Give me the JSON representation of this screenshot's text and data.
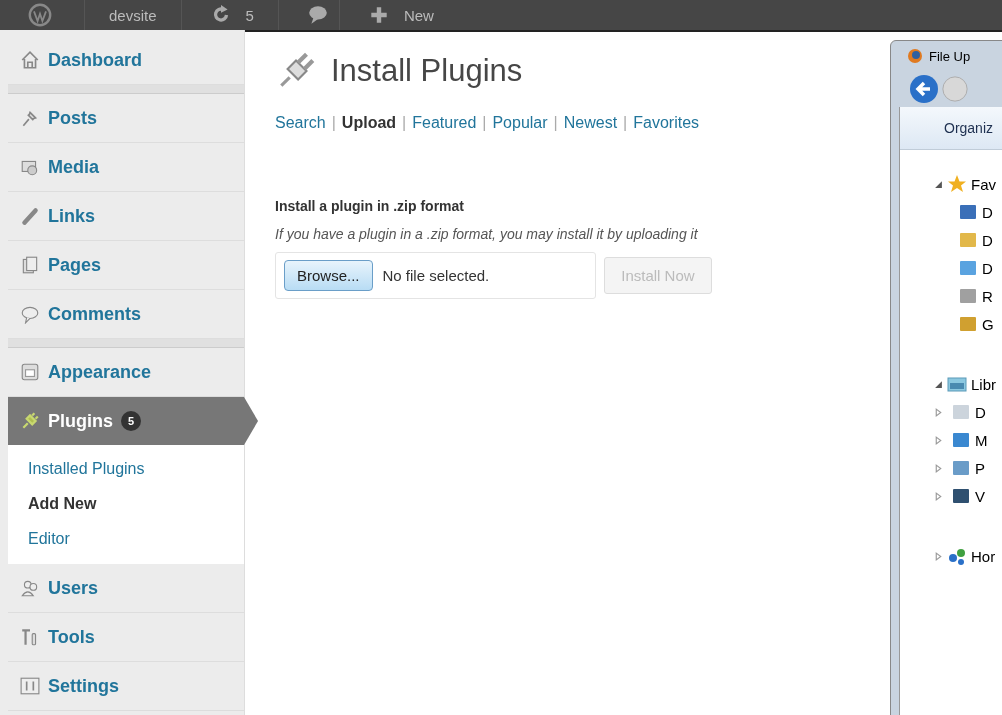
{
  "admin_bar": {
    "site": "devsite",
    "updates": "5",
    "new": "New"
  },
  "sidebar": {
    "items": [
      {
        "label": "Dashboard",
        "selected": false,
        "separator_after": true
      },
      {
        "label": "Posts",
        "selected": false
      },
      {
        "label": "Media",
        "selected": false
      },
      {
        "label": "Links",
        "selected": false
      },
      {
        "label": "Pages",
        "selected": false
      },
      {
        "label": "Comments",
        "selected": false,
        "separator_after": true
      },
      {
        "label": "Appearance",
        "selected": false
      },
      {
        "label": "Plugins",
        "selected": true,
        "badge": "5",
        "children": [
          {
            "label": "Installed Plugins",
            "selected": false
          },
          {
            "label": "Add New",
            "selected": true
          },
          {
            "label": "Editor",
            "selected": false
          }
        ]
      },
      {
        "label": "Users",
        "selected": false
      },
      {
        "label": "Tools",
        "selected": false
      },
      {
        "label": "Settings",
        "selected": false
      }
    ]
  },
  "page": {
    "title": "Install Plugins",
    "tabs": [
      {
        "label": "Search",
        "selected": false
      },
      {
        "label": "Upload",
        "selected": true
      },
      {
        "label": "Featured",
        "selected": false
      },
      {
        "label": "Popular",
        "selected": false
      },
      {
        "label": "Newest",
        "selected": false
      },
      {
        "label": "Favorites",
        "selected": false
      }
    ],
    "tab_separator": "|",
    "heading": "Install a plugin in .zip format",
    "description": "If you have a plugin in a .zip format, you may install it by uploading it",
    "browse_button": "Browse...",
    "file_status": "No file selected.",
    "install_button": "Install Now",
    "install_disabled": true
  },
  "dialog": {
    "title": "File Up",
    "toolbar": "Organiz",
    "tree": [
      {
        "label": "Fav",
        "expanded": true,
        "children": [
          {
            "label": "D"
          },
          {
            "label": "D"
          },
          {
            "label": "D"
          },
          {
            "label": "R"
          },
          {
            "label": "G"
          }
        ]
      },
      {
        "label": "Libr",
        "expanded": true,
        "children": [
          {
            "label": "D",
            "expanded": false
          },
          {
            "label": "M",
            "expanded": false
          },
          {
            "label": "P",
            "expanded": false
          },
          {
            "label": "V",
            "expanded": false
          }
        ]
      },
      {
        "label": "Hor",
        "expanded": false
      }
    ]
  }
}
